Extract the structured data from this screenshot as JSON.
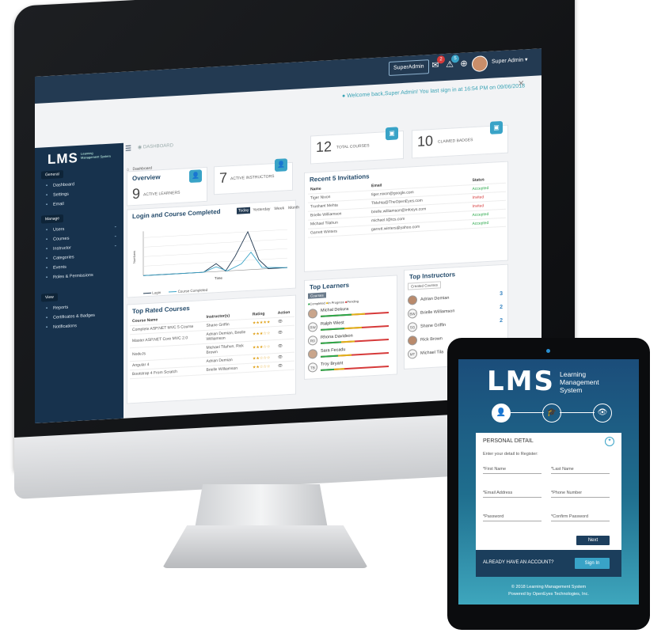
{
  "topbar": {
    "role_button": "SuperAdmin",
    "user_name": "Super Admin",
    "notif_count": "2",
    "alert_count": "5",
    "welcome": "Welcome back,Super Admin! You last sign in at 16:54 PM on 09/06/2018"
  },
  "sidebar": {
    "logo": "LMS",
    "logo_sub": "Learning Management System",
    "general_header": "General",
    "general_items": [
      {
        "label": "Dashboard",
        "icon": "dashboard-icon"
      },
      {
        "label": "Settings",
        "icon": "gear-icon"
      },
      {
        "label": "Email",
        "icon": "mail-icon"
      }
    ],
    "manage_header": "Manage",
    "manage_items": [
      {
        "label": "Users",
        "icon": "users-icon"
      },
      {
        "label": "Courses",
        "icon": "book-icon"
      },
      {
        "label": "Instructor",
        "icon": "instructor-icon"
      },
      {
        "label": "Categories",
        "icon": "tag-icon"
      },
      {
        "label": "Events",
        "icon": "calendar-icon"
      },
      {
        "label": "Roles & Permissions",
        "icon": "key-icon"
      }
    ],
    "view_header": "View",
    "view_items": [
      {
        "label": "Reports",
        "icon": "chart-icon"
      },
      {
        "label": "Certificates & Badges",
        "icon": "certificate-icon"
      },
      {
        "label": "Notifications",
        "icon": "bell-icon"
      }
    ]
  },
  "main": {
    "page_title": "DASHBOARD",
    "breadcrumb": "Dashboard",
    "overview_title": "Overview",
    "stats": [
      {
        "value": "9",
        "label": "ACTIVE LEARNERS"
      },
      {
        "value": "7",
        "label": "ACTIVE INSTRUCTORS"
      },
      {
        "value": "12",
        "label": "TOTAL COURSES"
      },
      {
        "value": "10",
        "label": "CLAIMED BADGES"
      }
    ],
    "login_chart": {
      "title": "Login and Course Completed",
      "filters": [
        "Today",
        "Yesterday",
        "Week",
        "Month"
      ],
      "ylabel": "Numbers",
      "xlabel": "Time",
      "legend": [
        "Login",
        "Course Completed"
      ]
    },
    "invitations": {
      "title": "Recent 5 Invitations",
      "headers": [
        "Name",
        "Email",
        "Status"
      ],
      "rows": [
        [
          "Tiger Nixon",
          "tiger.nixon@google.com",
          "Accepted"
        ],
        [
          "Trushant Mehta",
          "TMehta@TheOpenEyes.com",
          "Invited"
        ],
        [
          "Brielle Williamson",
          "brielle.williamson@infosys.com",
          "Invited"
        ],
        [
          "Michael Tilahun",
          "michael.t@tcs.com",
          "Accepted"
        ],
        [
          "Garrett Winters",
          "garrett.winters@yahoo.com",
          "Accepted"
        ]
      ]
    },
    "top_rated": {
      "title": "Top Rated Courses",
      "headers": [
        "Course Name",
        "Instructor(s)",
        "Rating",
        "Action"
      ],
      "rows": [
        [
          "Complete ASP.NET MVC 5 Course",
          "Shane Griffin",
          "★★★★★"
        ],
        [
          "Master ASP.NET Core MVC 2.0",
          "Adrian Demian, Brielle Williamson",
          "★★★☆☆"
        ],
        [
          "NodeJs",
          "Michael Tilahun, Rick Brown",
          "★★★☆☆"
        ],
        [
          "Angular 4",
          "Adrian Demian",
          "★★☆☆☆"
        ],
        [
          "Bootstrap 4 From Scratch",
          "Brielle Williamson",
          "★★☆☆☆"
        ]
      ]
    },
    "top_learners": {
      "title": "Top Learners",
      "tab": "Courses",
      "legend": [
        "Completed",
        "In Progress",
        "Pending"
      ],
      "rows": [
        {
          "name": "Michal Dekura",
          "initials": "",
          "completed": 0.45,
          "progress": 0.2
        },
        {
          "name": "Ralph Wiest",
          "initials": "RW",
          "completed": 0.35,
          "progress": 0.25
        },
        {
          "name": "Rhona Davidson",
          "initials": "RD",
          "completed": 0.3,
          "progress": 0.2
        },
        {
          "name": "Sara Fecadu",
          "initials": "",
          "completed": 0.25,
          "progress": 0.2
        },
        {
          "name": "Troy Bryant",
          "initials": "TB",
          "completed": 0.2,
          "progress": 0.15
        }
      ]
    },
    "top_instructors": {
      "title": "Top Instructors",
      "tab": "Created Courses",
      "rows": [
        {
          "name": "Adrian Demian",
          "initials": "",
          "count": "3"
        },
        {
          "name": "Brielle Williamson",
          "initials": "BW",
          "count": "2"
        },
        {
          "name": "Shane Griffin",
          "initials": "SG",
          "count": "2"
        },
        {
          "name": "Rick Brown",
          "initials": "",
          "count": ""
        },
        {
          "name": "Michael Tila",
          "initials": "MT",
          "count": ""
        }
      ]
    }
  },
  "tablet": {
    "logo": "LMS",
    "logo_sub": "Learning Management System",
    "form_title": "PERSONAL DETAIL",
    "hint": "Enter your detail to Register:",
    "fields": [
      "*First Name",
      "*Last Name",
      "*Email Address",
      "*Phone Number",
      "*Password",
      "*Confirm Password"
    ],
    "next": "Next",
    "account_q": "ALREADY HAVE AN ACCOUNT?",
    "signin": "Sign In",
    "footer1": "© 2018 Learning Management System",
    "footer2": "Powered by OpenEyes Technologies, Inc."
  },
  "colors": {
    "navy": "#17324d",
    "accent": "#39a3c7",
    "accepted": "#2aa84a",
    "invited": "#d63a3a"
  }
}
